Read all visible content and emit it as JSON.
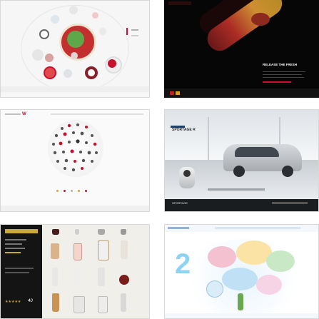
{
  "tiles": [
    {
      "id": "cosmetics-circle",
      "caption": "",
      "nav_small": "",
      "footer": ""
    },
    {
      "id": "bottle-dark",
      "release_title": "RELEASE THE FRESH",
      "release_sub": "",
      "top_menu": "",
      "footer": ""
    },
    {
      "id": "icon-sphere",
      "logo": "W"
    },
    {
      "id": "car-showroom",
      "model_logo": "SPORTAGE R",
      "brand_badge": "SPORTAGE"
    },
    {
      "id": "product-grid",
      "rating_text": "40",
      "stars": "★★★★★"
    },
    {
      "id": "illustration-map",
      "big_number": "2"
    }
  ],
  "colors": {
    "accent_red": "#c8102e",
    "gold": "#d4a229",
    "dark": "#0a0a0a",
    "kia_silver": "#bfc3c7",
    "sky": "#7fb6e6"
  }
}
